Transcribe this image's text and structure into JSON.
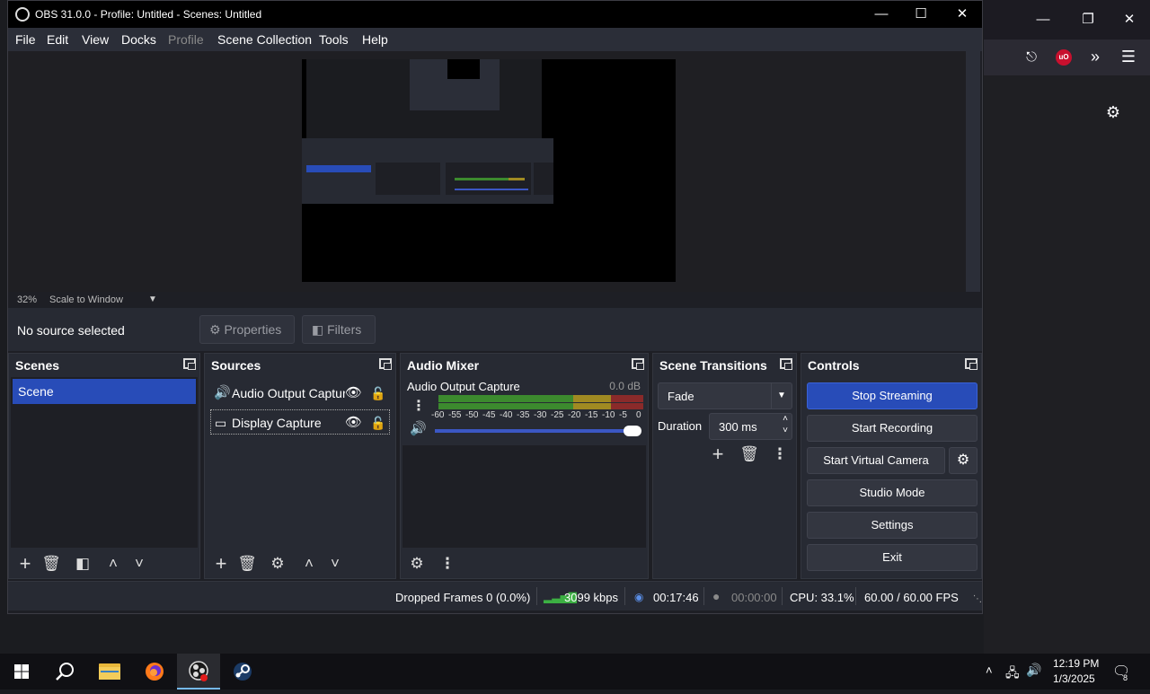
{
  "window": {
    "title": "OBS 31.0.0 - Profile: Untitled - Scenes: Untitled"
  },
  "menu": [
    "File",
    "Edit",
    "View",
    "Docks",
    "Profile",
    "Scene Collection",
    "Tools",
    "Help"
  ],
  "preview": {
    "zoom": "32%",
    "scale_mode": "Scale to Window"
  },
  "context_bar": {
    "no_source": "No source selected",
    "properties_label": "Properties",
    "filters_label": "Filters"
  },
  "docks": {
    "scenes": {
      "title": "Scenes",
      "items": [
        "Scene"
      ]
    },
    "sources": {
      "title": "Sources",
      "items": [
        "Audio Output Captur",
        "Display Capture"
      ]
    },
    "audio_mixer": {
      "title": "Audio Mixer",
      "channel_name": "Audio Output Capture",
      "channel_db": "0.0 dB",
      "scale_labels": [
        "-60",
        "-55",
        "-50",
        "-45",
        "-40",
        "-35",
        "-30",
        "-25",
        "-20",
        "-15",
        "-10",
        "-5",
        "0"
      ],
      "volume_fraction": 1.0
    },
    "transitions": {
      "title": "Scene Transitions",
      "transition": "Fade",
      "duration_label": "Duration",
      "duration_value": "300 ms"
    },
    "controls": {
      "title": "Controls",
      "stop_streaming": "Stop Streaming",
      "start_recording": "Start Recording",
      "start_virtual_camera": "Start Virtual Camera",
      "studio_mode": "Studio Mode",
      "settings": "Settings",
      "exit": "Exit"
    }
  },
  "status": {
    "dropped_frames": "Dropped Frames 0 (0.0%)",
    "bitrate": "3099 kbps",
    "stream_time": "00:17:46",
    "record_time": "00:00:00",
    "cpu": "CPU: 33.1%",
    "fps": "60.00 / 60.00 FPS"
  },
  "taskbar": {
    "time": "12:19 PM",
    "date": "1/3/2025",
    "notifications": "8"
  },
  "colors": {
    "accent": "#284cb8",
    "meter_green": "#3c8a2e",
    "meter_yellow": "#a08a22",
    "meter_red": "#8a2a2a"
  }
}
